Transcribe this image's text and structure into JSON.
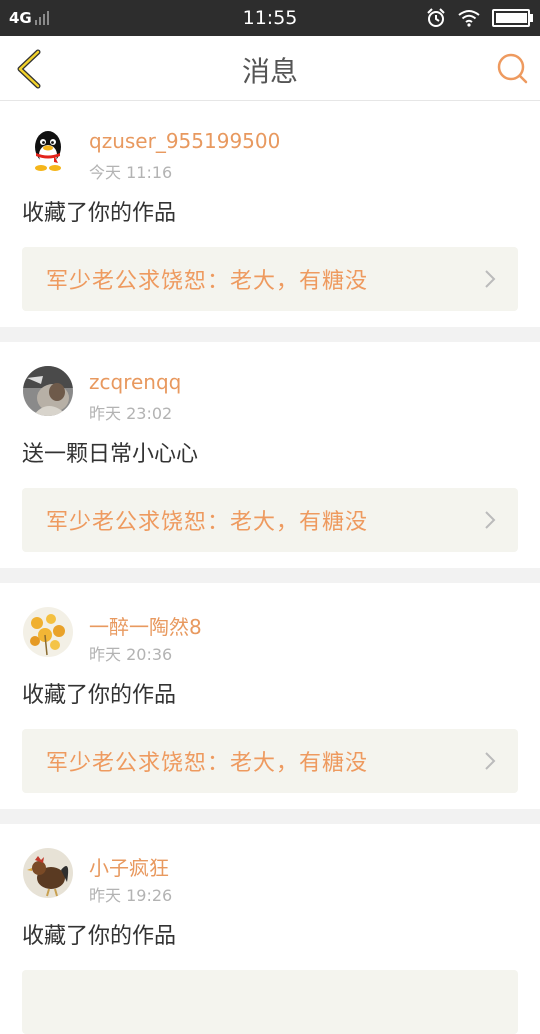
{
  "status_bar": {
    "network": "4G",
    "time": "11:55"
  },
  "header": {
    "title": "消息"
  },
  "messages": [
    {
      "username": "qzuser_955199500",
      "time": "今天 11:16",
      "action": "收藏了你的作品",
      "work_title": "军少老公求饶恕：老大，有糖没",
      "avatar": "qq-penguin-avatar"
    },
    {
      "username": "zcqrenqq",
      "time": "昨天 23:02",
      "action": "送一颗日常小心心",
      "work_title": "军少老公求饶恕：老大，有糖没",
      "avatar": "photo-avatar"
    },
    {
      "username": "一醉一陶然8",
      "time": "昨天 20:36",
      "action": "收藏了你的作品",
      "work_title": "军少老公求饶恕：老大，有糖没",
      "avatar": "flower-avatar"
    },
    {
      "username": "小子疯狂",
      "time": "昨天 19:26",
      "action": "收藏了你的作品",
      "work_title": "",
      "avatar": "rooster-avatar"
    }
  ],
  "colors": {
    "accent": "#e8995f",
    "status_bar": "#2d2d2d",
    "reference_bg": "#f4f4ee"
  }
}
